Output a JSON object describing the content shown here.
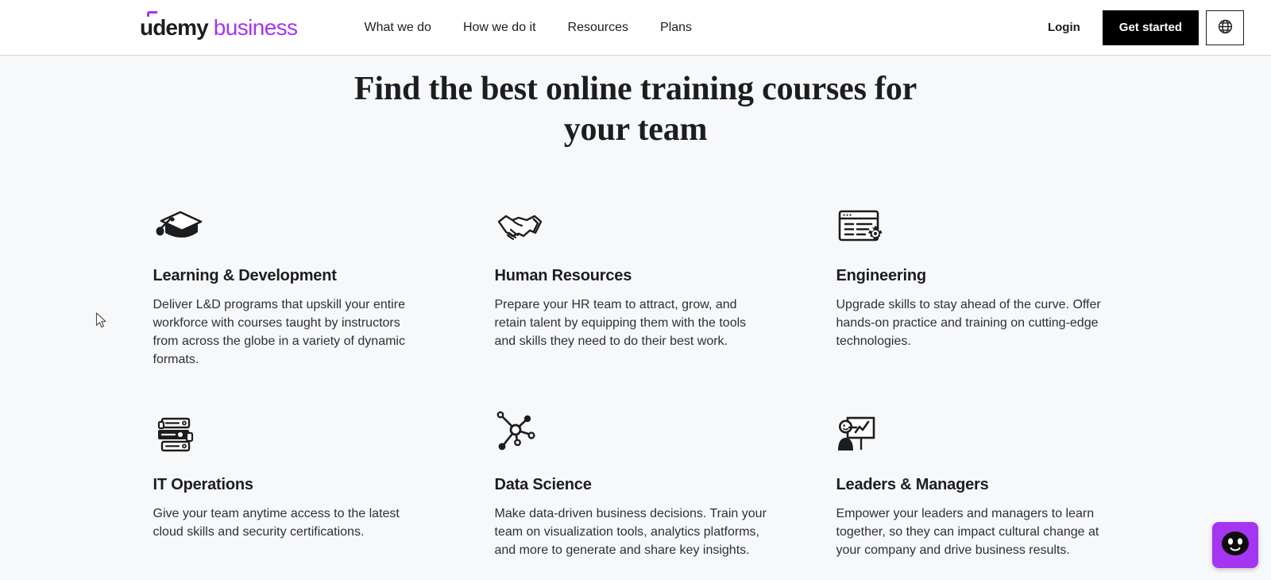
{
  "header": {
    "logo": {
      "word_primary": "udemy",
      "word_secondary": "business",
      "accent_color": "#a435f0"
    },
    "nav": [
      {
        "label": "What we do"
      },
      {
        "label": "How we do it"
      },
      {
        "label": "Resources"
      },
      {
        "label": "Plans"
      }
    ],
    "login_label": "Login",
    "get_started_label": "Get started",
    "language_icon": "globe-icon"
  },
  "main": {
    "title": "Find the best online training courses for your team",
    "cards": [
      {
        "icon": "graduation-cap-icon",
        "title": "Learning & Development",
        "description": "Deliver L&D programs that upskill your entire workforce with courses taught by instructors from across the globe in a variety of dynamic formats."
      },
      {
        "icon": "handshake-icon",
        "title": "Human Resources",
        "description": "Prepare your HR team to attract, grow, and retain talent by equipping them with the tools and skills they need to do their best work."
      },
      {
        "icon": "browser-gear-icon",
        "title": "Engineering",
        "description": "Upgrade skills to stay ahead of the curve. Offer hands-on practice and training on cutting-edge technologies."
      },
      {
        "icon": "server-rack-icon",
        "title": "IT Operations",
        "description": "Give your team anytime access to the latest cloud skills and security certifications."
      },
      {
        "icon": "network-nodes-icon",
        "title": "Data Science",
        "description": "Make data-driven business decisions. Train your team on visualization tools, analytics platforms, and more to generate and share key insights."
      },
      {
        "icon": "presenter-chart-icon",
        "title": "Leaders & Managers",
        "description": "Empower your leaders and managers to learn together, so they can impact cultural change at your company and drive business results."
      }
    ]
  },
  "chat_widget": {
    "icon": "chat-bot-face-icon",
    "background_color": "#a435f0"
  },
  "colors": {
    "page_background": "#f7f8fa",
    "header_background": "#ffffff",
    "text_primary": "#1c1d1f",
    "text_body": "#2d2f31",
    "accent_purple": "#a435f0",
    "button_primary": "#000000"
  }
}
